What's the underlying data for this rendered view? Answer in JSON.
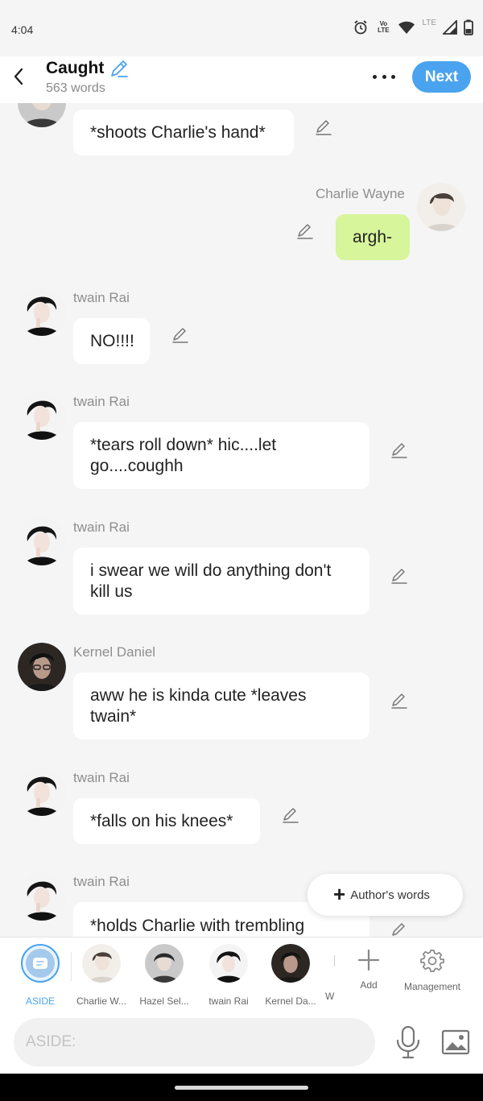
{
  "status_bar": {
    "time": "4:04",
    "volte": "Vo LTE",
    "network": "LTE"
  },
  "header": {
    "title": "Caught",
    "word_count": "563 words",
    "next_label": "Next"
  },
  "messages": [
    {
      "sender": "",
      "text": "*shoots Charlie's hand*",
      "mine": false
    },
    {
      "sender": "Charlie Wayne",
      "text": "argh-",
      "mine": true
    },
    {
      "sender": "twain Rai",
      "text": "NO!!!!",
      "mine": false
    },
    {
      "sender": "twain Rai",
      "text": "*tears roll down* hic....let go....coughh",
      "mine": false
    },
    {
      "sender": "twain Rai",
      "text": "i swear we will do anything don't kill us",
      "mine": false
    },
    {
      "sender": "Kernel Daniel",
      "text": "aww he is kinda cute *leaves twain*",
      "mine": false
    },
    {
      "sender": "twain Rai",
      "text": "*falls on his knees*",
      "mine": false
    },
    {
      "sender": "twain Rai",
      "text": "*holds Charlie with trembling",
      "mine": false
    }
  ],
  "fab": {
    "label": "Author's words"
  },
  "character_bar": {
    "items": [
      {
        "label": "ASIDE"
      },
      {
        "label": "Charlie W..."
      },
      {
        "label": "Hazel Sel..."
      },
      {
        "label": "twain Rai"
      },
      {
        "label": "Kernel Da..."
      }
    ],
    "partial_label": "W",
    "add_label": "Add",
    "management_label": "Management"
  },
  "input": {
    "placeholder": "ASIDE:"
  },
  "colors": {
    "accent": "#4aa3ee",
    "my_bubble": "#d7f59a",
    "background": "#f5f5f5"
  }
}
